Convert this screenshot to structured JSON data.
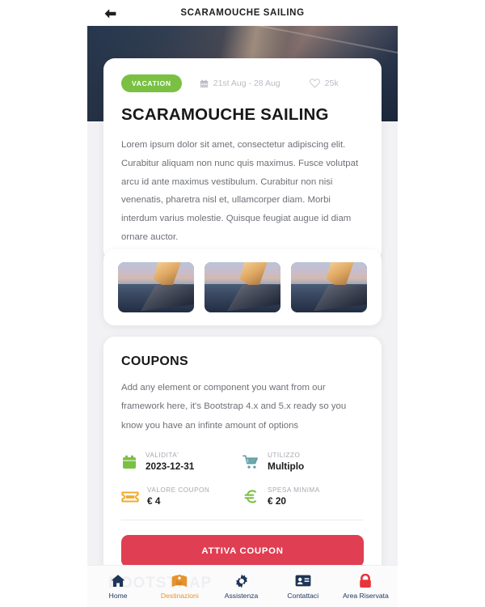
{
  "header": {
    "back_icon": "arrow-left-icon",
    "title": "SCARAMOUCHE SAILING"
  },
  "detail": {
    "badge": "VACATION",
    "calendar_icon": "calendar-icon",
    "date_range": "21st Aug - 28 Aug",
    "heart_icon": "heart-outline-icon",
    "likes": "25k",
    "title": "SCARAMOUCHE SAILING",
    "body": "Lorem ipsum dolor sit amet, consectetur adipiscing elit. Curabitur aliquam non nunc quis maximus. Fusce volutpat arcu id ante maximus vestibulum. Curabitur non nisi venenatis, pharetra nisl et, ullamcorper diam. Morbi interdum varius molestie. Quisque feugiat augue id diam ornare auctor."
  },
  "gallery": {
    "thumbnails": [
      {
        "alt": "sailing-boat-sunset-1"
      },
      {
        "alt": "sailing-boat-sunset-2"
      },
      {
        "alt": "sailing-boat-sunset-3"
      }
    ]
  },
  "coupons": {
    "title": "COUPONS",
    "description": "Add any element or component you want from our framework here, it's Bootstrap 4.x and 5.x ready so you know you have an infinte amount of options",
    "stats": [
      {
        "icon": "calendar-icon",
        "icon_color": "#7ac143",
        "label": "VALIDITA'",
        "value": "2023-12-31"
      },
      {
        "icon": "shopping-cart-icon",
        "icon_color": "#5f9ea0",
        "label": "UTILIZZO",
        "value": "Multiplo"
      },
      {
        "icon": "ticket-icon",
        "icon_color": "#f0ab2e",
        "label": "VALORE COUPON",
        "value": "€ 4"
      },
      {
        "icon": "euro-icon",
        "icon_color": "#7ac143",
        "label": "SPESA MINIMA",
        "value": "€ 20"
      }
    ],
    "cta_label": "ATTIVA COUPON",
    "cta_color": "#e03e52"
  },
  "bottom_nav": {
    "watermark": "BOOTSTRAP",
    "active_color": "#e8922c",
    "items": [
      {
        "icon": "home-icon",
        "label": "Home",
        "color": "#1d3557",
        "active": false
      },
      {
        "icon": "map-pin-icon",
        "label": "Destinazioni",
        "color": "#e8922c",
        "active": true
      },
      {
        "icon": "gear-icon",
        "label": "Assistenza",
        "color": "#1d3557",
        "active": false
      },
      {
        "icon": "id-card-icon",
        "label": "Contattaci",
        "color": "#1d3557",
        "active": false
      },
      {
        "icon": "lock-icon",
        "label": "Area Riservata",
        "color": "#e8343b",
        "active": false
      }
    ]
  }
}
